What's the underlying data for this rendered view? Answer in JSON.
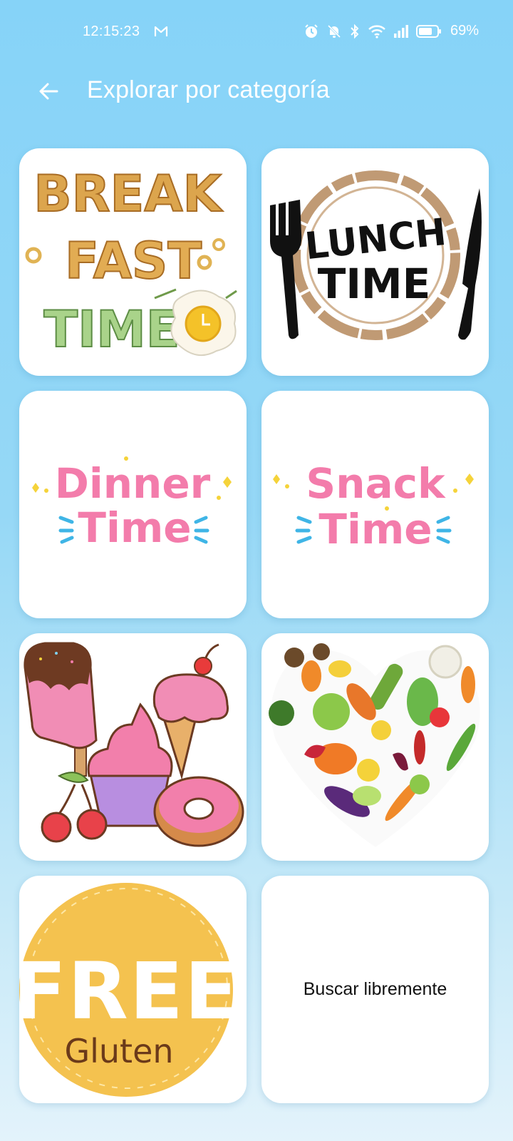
{
  "status_bar": {
    "time": "12:15:23",
    "mail_icon": "gmail-icon",
    "battery_percent": "69%",
    "icons": [
      "alarm-icon",
      "mute-icon",
      "bluetooth-icon",
      "wifi-icon",
      "signal-icon",
      "battery-icon"
    ]
  },
  "header": {
    "back_icon": "arrow-left-icon",
    "title": "Explorar por categoría"
  },
  "categories": [
    {
      "id": "breakfast",
      "art_text": [
        "BREAK",
        "FAST",
        "TIME"
      ]
    },
    {
      "id": "lunch",
      "art_text": [
        "LUNCH",
        "TIME"
      ]
    },
    {
      "id": "dinner",
      "art_text": [
        "Dinner",
        "Time"
      ]
    },
    {
      "id": "snack",
      "art_text": [
        "Snack",
        "Time"
      ]
    },
    {
      "id": "desserts"
    },
    {
      "id": "vegetables"
    },
    {
      "id": "gluten-free",
      "art_text": [
        "FREE",
        "Gluten"
      ]
    },
    {
      "id": "free-search",
      "label": "Buscar libremente"
    }
  ],
  "colors": {
    "background_top": "#86d3f8",
    "background_bottom": "#e3f3fb",
    "tile": "#ffffff",
    "pink": "#f37cab",
    "yellow": "#f5c451"
  }
}
